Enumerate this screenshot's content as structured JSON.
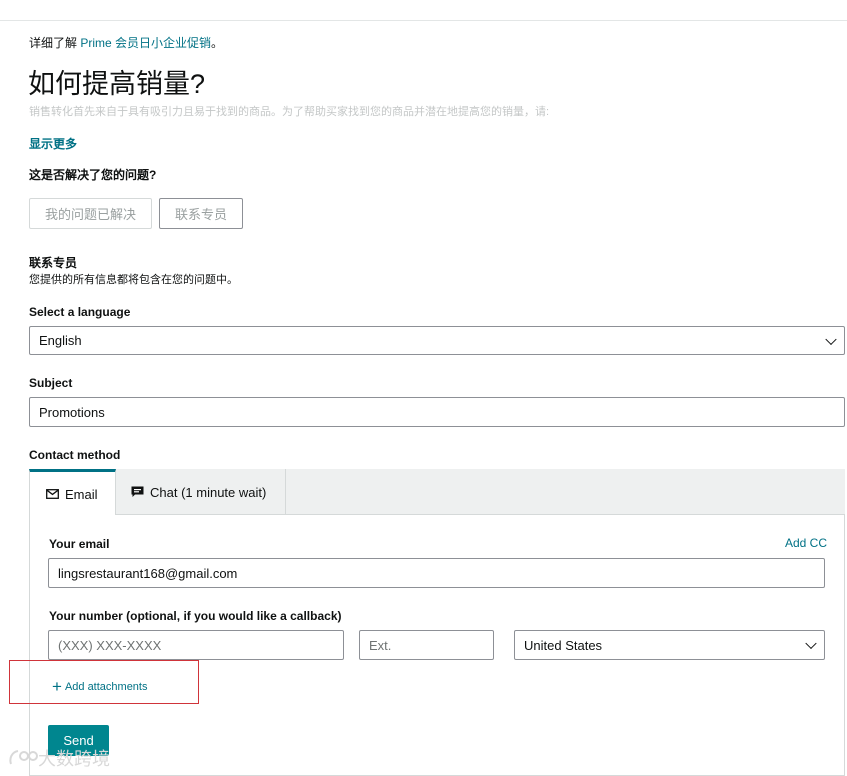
{
  "promo": {
    "prefix": "详细了解 ",
    "link": "Prime 会员日小企业促销",
    "suffix": "。"
  },
  "article": {
    "title": "如何提高销量?",
    "description": "销售转化首先来自于具有吸引力且易于找到的商品。为了帮助买家找到您的商品并潜在地提高您的销量，请:",
    "show_more": "显示更多"
  },
  "feedback": {
    "question": "这是否解决了您的问题?",
    "resolved_button": "我的问题已解决",
    "contact_button": "联系专员"
  },
  "contact": {
    "heading": "联系专员",
    "subtext": "您提供的所有信息都将包含在您的问题中。"
  },
  "form": {
    "language_label": "Select a language",
    "language_value": "English",
    "subject_label": "Subject",
    "subject_value": "Promotions",
    "contact_method_label": "Contact method",
    "tabs": [
      {
        "label": "Email",
        "icon": "envelope-icon",
        "active": true
      },
      {
        "label": "Chat (1 minute wait)",
        "icon": "chat-bubble-icon",
        "active": false
      }
    ],
    "email_label": "Your email",
    "add_cc": "Add CC",
    "email_value": "lingsrestaurant168@gmail.com",
    "number_label": "Your number (optional, if you would like a callback)",
    "phone_placeholder": "(XXX) XXX-XXXX",
    "ext_placeholder": "Ext.",
    "country_value": "United States",
    "add_attachments": "Add attachments",
    "send_button": "Send"
  },
  "watermark": {
    "text": "大数跨境"
  },
  "colors": {
    "link": "#007185",
    "send_button": "#00868f",
    "highlight_box": "#d0343a",
    "active_tab": "#007185"
  }
}
